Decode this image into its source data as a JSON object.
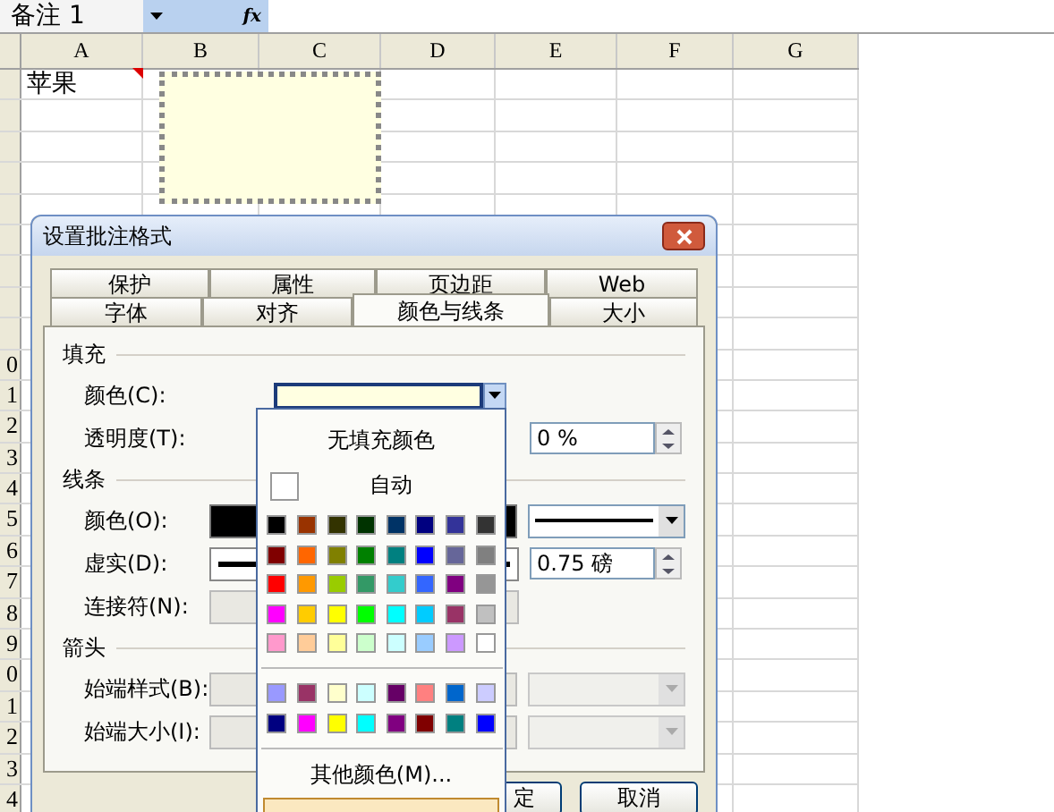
{
  "name_box": {
    "value": "备注 1"
  },
  "formula_bar": {
    "fx": "fx"
  },
  "columns": [
    "A",
    "B",
    "C",
    "D",
    "E",
    "F",
    "G"
  ],
  "first_row_cells": [
    "苹果"
  ],
  "row_headers_visible": [
    "0",
    "1",
    "2",
    "3",
    "4",
    "5",
    "6",
    "7",
    "8",
    "9",
    "0",
    "1",
    "2",
    "3",
    "4"
  ],
  "dialog": {
    "title": "设置批注格式",
    "tabs_back": [
      {
        "label": "保护",
        "selected": false
      },
      {
        "label": "属性",
        "selected": false
      },
      {
        "label": "页边距",
        "selected": false
      },
      {
        "label": "Web",
        "selected": false
      }
    ],
    "tabs_front": [
      {
        "label": "字体",
        "selected": false
      },
      {
        "label": "对齐",
        "selected": false
      },
      {
        "label": "颜色与线条",
        "selected": true
      },
      {
        "label": "大小",
        "selected": false
      }
    ],
    "sections": [
      {
        "title": "填充",
        "rows": [
          {
            "label": "颜色(C):",
            "kind": "color",
            "right": null
          },
          {
            "label": "透明度(T):",
            "kind": "none",
            "right": {
              "kind": "spin",
              "value": "0 %",
              "disabled": false
            }
          }
        ]
      },
      {
        "title": "线条",
        "rows": [
          {
            "label": "颜色(O):",
            "kind": "black",
            "right": {
              "kind": "line",
              "disabled": false
            }
          },
          {
            "label": "虚实(D):",
            "kind": "dash",
            "right": {
              "kind": "spin",
              "value": "0.75 磅",
              "disabled": false
            }
          },
          {
            "label": "连接符(N):",
            "kind": "grey",
            "right": null
          }
        ]
      },
      {
        "title": "箭头",
        "rows": [
          {
            "label": "始端样式(B):",
            "kind": "grey",
            "right": {
              "kind": "combo",
              "disabled": true
            }
          },
          {
            "label": "始端大小(I):",
            "kind": "grey",
            "right": {
              "kind": "combo",
              "disabled": true
            }
          }
        ]
      }
    ],
    "buttons": [
      {
        "label": "定"
      },
      {
        "label": "取消"
      }
    ]
  },
  "color_popup": {
    "no_fill": "无填充颜色",
    "auto": "自动",
    "more": "其他颜色(M)...",
    "standard": [
      [
        {
          "color": "#000000"
        },
        {
          "color": "#993300"
        },
        {
          "color": "#333300"
        },
        {
          "color": "#003300"
        },
        {
          "color": "#003366"
        },
        {
          "color": "#000080"
        },
        {
          "color": "#333399"
        },
        {
          "color": "#333333"
        }
      ],
      [
        {
          "color": "#800000"
        },
        {
          "color": "#ff6600"
        },
        {
          "color": "#808000"
        },
        {
          "color": "#008000"
        },
        {
          "color": "#008080"
        },
        {
          "color": "#0000ff"
        },
        {
          "color": "#666699"
        },
        {
          "color": "#808080"
        }
      ],
      [
        {
          "color": "#ff0000"
        },
        {
          "color": "#ff9900"
        },
        {
          "color": "#99cc00"
        },
        {
          "color": "#339966"
        },
        {
          "color": "#33cccc"
        },
        {
          "color": "#3366ff"
        },
        {
          "color": "#800080"
        },
        {
          "color": "#969696"
        }
      ],
      [
        {
          "color": "#ff00ff"
        },
        {
          "color": "#ffcc00"
        },
        {
          "color": "#ffff00"
        },
        {
          "color": "#00ff00"
        },
        {
          "color": "#00ffff"
        },
        {
          "color": "#00ccff"
        },
        {
          "color": "#993366"
        },
        {
          "color": "#c0c0c0"
        }
      ],
      [
        {
          "color": "#ff99cc"
        },
        {
          "color": "#ffcc99"
        },
        {
          "color": "#ffff99"
        },
        {
          "color": "#ccffcc"
        },
        {
          "color": "#ccffff"
        },
        {
          "color": "#99ccff"
        },
        {
          "color": "#cc99ff"
        },
        {
          "color": "#ffffff"
        }
      ]
    ],
    "extra": [
      [
        {
          "color": "#9999ff"
        },
        {
          "color": "#993366"
        },
        {
          "color": "#ffffcc"
        },
        {
          "color": "#ccffff"
        },
        {
          "color": "#660066"
        },
        {
          "color": "#ff8080"
        },
        {
          "color": "#0066cc"
        },
        {
          "color": "#ccccff"
        }
      ],
      [
        {
          "color": "#000080"
        },
        {
          "color": "#ff00ff"
        },
        {
          "color": "#ffff00"
        },
        {
          "color": "#00ffff"
        },
        {
          "color": "#800080"
        },
        {
          "color": "#800000"
        },
        {
          "color": "#008080"
        },
        {
          "color": "#0000ff"
        }
      ]
    ]
  }
}
